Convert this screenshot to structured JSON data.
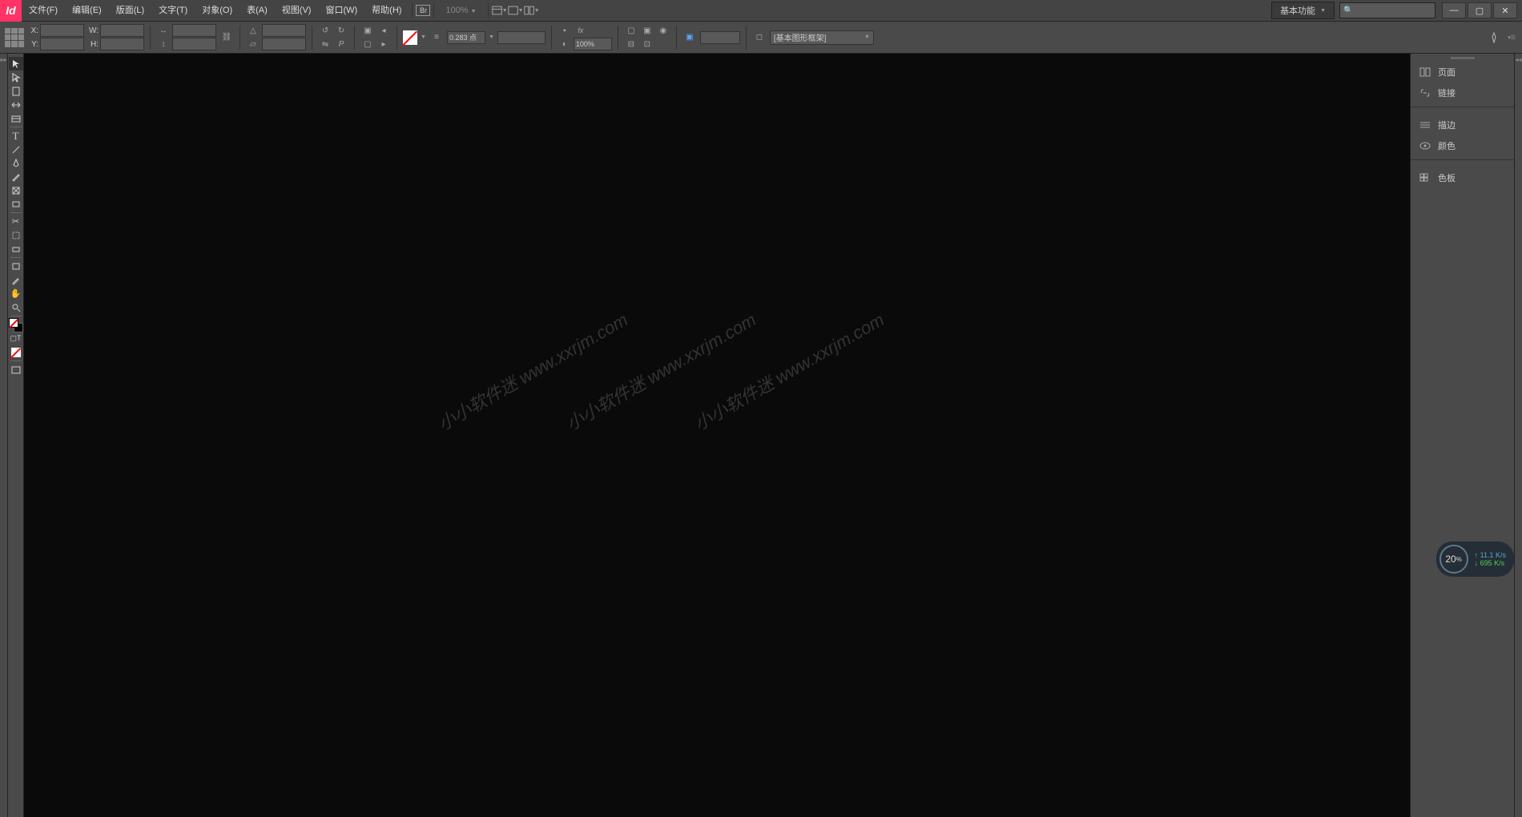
{
  "app": {
    "logo": "Id"
  },
  "menu": [
    "文件(F)",
    "编辑(E)",
    "版面(L)",
    "文字(T)",
    "对象(O)",
    "表(A)",
    "视图(V)",
    "窗口(W)",
    "帮助(H)"
  ],
  "menubar_extra": {
    "bridge": "Br",
    "zoom": "100%",
    "workspace": "基本功能"
  },
  "control": {
    "x_label": "X:",
    "y_label": "Y:",
    "w_label": "W:",
    "h_label": "H:",
    "stroke_weight": "0.283 点",
    "opacity": "100%",
    "frame_style": "[基本图形框架]"
  },
  "panels": {
    "pages": "页面",
    "links": "链接",
    "stroke": "描边",
    "color": "颜色",
    "swatches": "色板"
  },
  "watermark": "小小软件迷 www.xxrjm.com",
  "net": {
    "pct": "20",
    "pct_unit": "%",
    "up": "11.1",
    "down": "695",
    "unit": "K/s"
  }
}
